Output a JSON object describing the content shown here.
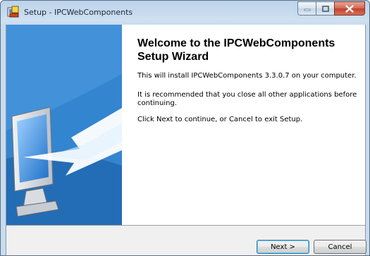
{
  "window": {
    "title": "Setup - IPCWebComponents"
  },
  "caption_buttons": {
    "minimize_icon": "minimize-icon",
    "maximize_icon": "maximize-icon",
    "close_icon": "close-icon"
  },
  "welcome": {
    "heading": "Welcome to the IPCWebComponents Setup Wizard",
    "paragraph1": "This will install IPCWebComponents 3.3.0.7 on your computer.",
    "paragraph2": "It is recommended that you close all other applications before continuing.",
    "paragraph3": "Click Next to continue, or Cancel to exit Setup."
  },
  "buttons": {
    "next": "Next >",
    "cancel": "Cancel"
  },
  "colors": {
    "side_panel": "#2e82c8",
    "close_button": "#c2402a",
    "default_button_border": "#3c7fb1"
  }
}
